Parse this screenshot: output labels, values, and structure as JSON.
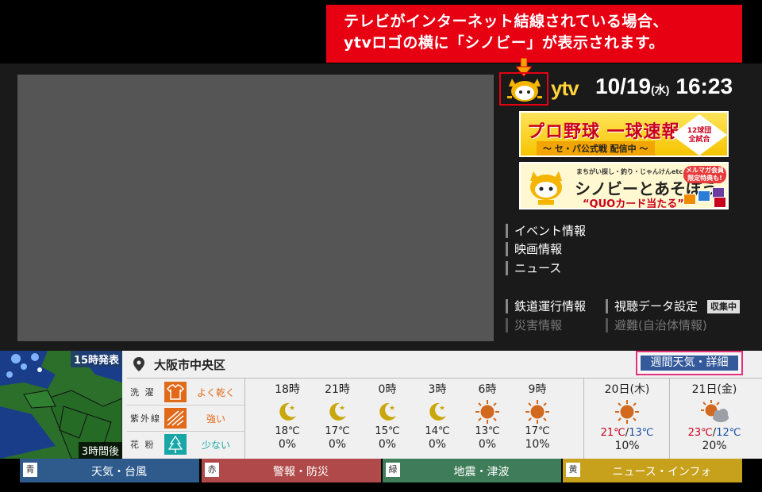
{
  "callout": {
    "line1": "テレビがインターネット結線されている場合、",
    "line2": "ytvロゴの横に「シノビー」が表示されます。"
  },
  "header": {
    "logo": "ytv",
    "date": "10/19",
    "day_of_week": "(水)",
    "time": "16:23"
  },
  "banners": {
    "baseball": {
      "title": "プロ野球 一球速報",
      "subtitle": "〜 セ・パ公式戦 配信中 〜",
      "badge_line1": "12球団",
      "badge_line2": "全試合"
    },
    "shinobi": {
      "small": "まちがい探し・釣り・じゃんけんetc.",
      "title": "シノビーとあそぼう",
      "prize": "“QUOカード当たる”",
      "tag": "メルマガ会員限定特典も!"
    }
  },
  "menu": {
    "event": "イベント情報",
    "movie": "映画情報",
    "news": "ニュース",
    "rail": "鉄道運行情報",
    "viewing": "視聴データ設定",
    "collecting": "収集中",
    "disaster": "災害情報",
    "evacuation": "避難(自治体情報)"
  },
  "weather": {
    "radar_issued": "15時発表",
    "radar_span": "3時間後",
    "location": "大阪市中央区",
    "weekly_button": "週間天気・詳細",
    "life_indices": [
      {
        "label": "洗 濯",
        "value": "よく乾く",
        "color": "#e06a1a",
        "icon": "shirt-icon"
      },
      {
        "label": "紫外線",
        "value": "強い",
        "color": "#e06a1a",
        "icon": "uv-icon"
      },
      {
        "label": "花 粉",
        "value": "少ない",
        "color": "#18a6a6",
        "icon": "tree-icon"
      }
    ],
    "hourly": [
      {
        "time": "18時",
        "icon": "moon-icon",
        "temp": "18℃",
        "pop": "0%"
      },
      {
        "time": "21時",
        "icon": "moon-icon",
        "temp": "17℃",
        "pop": "0%"
      },
      {
        "time": "0時",
        "icon": "moon-icon",
        "temp": "15℃",
        "pop": "0%"
      },
      {
        "time": "3時",
        "icon": "moon-icon",
        "temp": "14℃",
        "pop": "0%"
      },
      {
        "time": "6時",
        "icon": "sun-icon",
        "temp": "13℃",
        "pop": "0%"
      },
      {
        "time": "9時",
        "icon": "sun-icon",
        "temp": "17℃",
        "pop": "10%"
      }
    ],
    "daily": [
      {
        "date": "20日(木)",
        "icon": "sun-icon",
        "high": "21℃",
        "low": "13℃",
        "pop": "10%"
      },
      {
        "date": "21日(金)",
        "icon": "sun-cloud-icon",
        "high": "23℃",
        "low": "12℃",
        "pop": "20%"
      }
    ]
  },
  "color_buttons": [
    {
      "key": "青",
      "label": "天気・台風",
      "color": "#2e5a8c"
    },
    {
      "key": "赤",
      "label": "警報・防災",
      "color": "#b04a4a"
    },
    {
      "key": "緑",
      "label": "地震・津波",
      "color": "#3f7d5a"
    },
    {
      "key": "黄",
      "label": "ニュース・インフォ",
      "color": "#c7a01c"
    }
  ]
}
